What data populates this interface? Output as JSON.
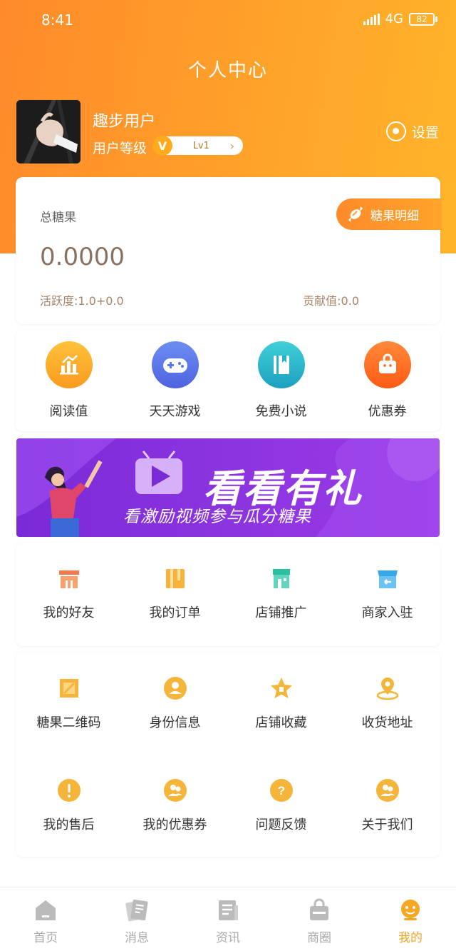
{
  "status_bar": {
    "time": "8:41",
    "network": "4G",
    "battery": "82"
  },
  "header": {
    "title": "个人中心"
  },
  "user": {
    "name": "趣步用户",
    "level_label": "用户等级",
    "level_badge": "V",
    "level": "Lv1",
    "settings_label": "设置"
  },
  "candy": {
    "title": "总糖果",
    "value": "0.0000",
    "detail_button": "糖果明细",
    "activity": "活跃度:1.0+0.0",
    "contribution": "贡献值:0.0"
  },
  "quick_links": [
    {
      "label": "阅读值",
      "icon": "chart-growth-icon",
      "color": "#f7a623"
    },
    {
      "label": "天天游戏",
      "icon": "gamepad-icon",
      "color": "#5a78e8"
    },
    {
      "label": "免费小说",
      "icon": "book-icon",
      "color": "#26b2c8"
    },
    {
      "label": "优惠券",
      "icon": "shopping-bag-icon",
      "color": "#ff6a1a"
    }
  ],
  "banner": {
    "title": "看看有礼",
    "subtitle": "看激励视频参与瓜分糖果"
  },
  "menu_primary": [
    {
      "label": "我的好友",
      "icon": "friends-icon",
      "color": "#f5794a"
    },
    {
      "label": "我的订单",
      "icon": "order-icon",
      "color": "#f9b23a"
    },
    {
      "label": "店铺推广",
      "icon": "store-promote-icon",
      "color": "#2bc0a0"
    },
    {
      "label": "商家入驻",
      "icon": "merchant-icon",
      "color": "#38a9e8"
    }
  ],
  "menu_secondary": [
    {
      "label": "糖果二维码",
      "icon": "candy-qrcode-icon"
    },
    {
      "label": "身份信息",
      "icon": "identity-icon"
    },
    {
      "label": "店铺收藏",
      "icon": "store-favorite-icon"
    },
    {
      "label": "收货地址",
      "icon": "address-icon"
    },
    {
      "label": "我的售后",
      "icon": "after-sales-icon"
    },
    {
      "label": "我的优惠券",
      "icon": "my-coupon-icon"
    },
    {
      "label": "问题反馈",
      "icon": "feedback-icon"
    },
    {
      "label": "关于我们",
      "icon": "about-icon"
    }
  ],
  "tab_bar": [
    {
      "label": "首页",
      "icon": "home-icon"
    },
    {
      "label": "消息",
      "icon": "message-icon"
    },
    {
      "label": "资讯",
      "icon": "news-icon"
    },
    {
      "label": "商圈",
      "icon": "shop-bag-icon"
    },
    {
      "label": "我的",
      "icon": "profile-icon",
      "active": true
    }
  ],
  "colors": {
    "brand": "#ff9a2a",
    "accent": "#f5a623",
    "secondary_icon": "#f5b53a"
  }
}
